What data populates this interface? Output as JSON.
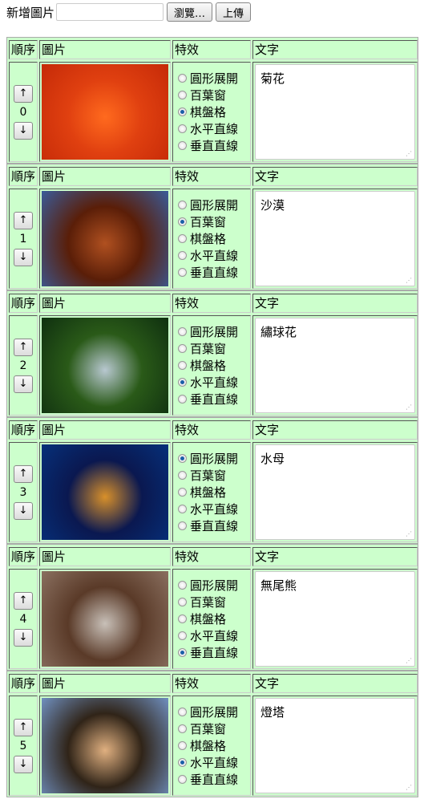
{
  "upload": {
    "label": "新增圖片",
    "browse": "瀏覽…",
    "submit": "上傳"
  },
  "headers": {
    "order": "順序",
    "image": "圖片",
    "effect": "特效",
    "text": "文字"
  },
  "arrows": {
    "up": "↑",
    "down": "↓"
  },
  "effects": [
    "圓形展開",
    "百葉窗",
    "棋盤格",
    "水平直線",
    "垂直直線"
  ],
  "items": [
    {
      "order": "0",
      "text": "菊花",
      "selected": 2,
      "image": "chrysanthemum",
      "colors": [
        "#c52a08",
        "#ff6a1e",
        "#e04010"
      ]
    },
    {
      "order": "1",
      "text": "沙漠",
      "selected": 1,
      "image": "desert",
      "colors": [
        "#3a5c9a",
        "#b05020",
        "#5a1e08"
      ]
    },
    {
      "order": "2",
      "text": "繡球花",
      "selected": 3,
      "image": "hydrangea",
      "colors": [
        "#0f3010",
        "#b8c8d0",
        "#2a5a18"
      ]
    },
    {
      "order": "3",
      "text": "水母",
      "selected": 0,
      "image": "jellyfish",
      "colors": [
        "#06307a",
        "#d8902a",
        "#0a1850"
      ]
    },
    {
      "order": "4",
      "text": "無尾熊",
      "selected": 4,
      "image": "koala",
      "colors": [
        "#8a7060",
        "#c8c0b8",
        "#5a3a28"
      ]
    },
    {
      "order": "5",
      "text": "燈塔",
      "selected": 3,
      "image": "lighthouse",
      "colors": [
        "#7090c0",
        "#e0b080",
        "#302418"
      ]
    }
  ]
}
